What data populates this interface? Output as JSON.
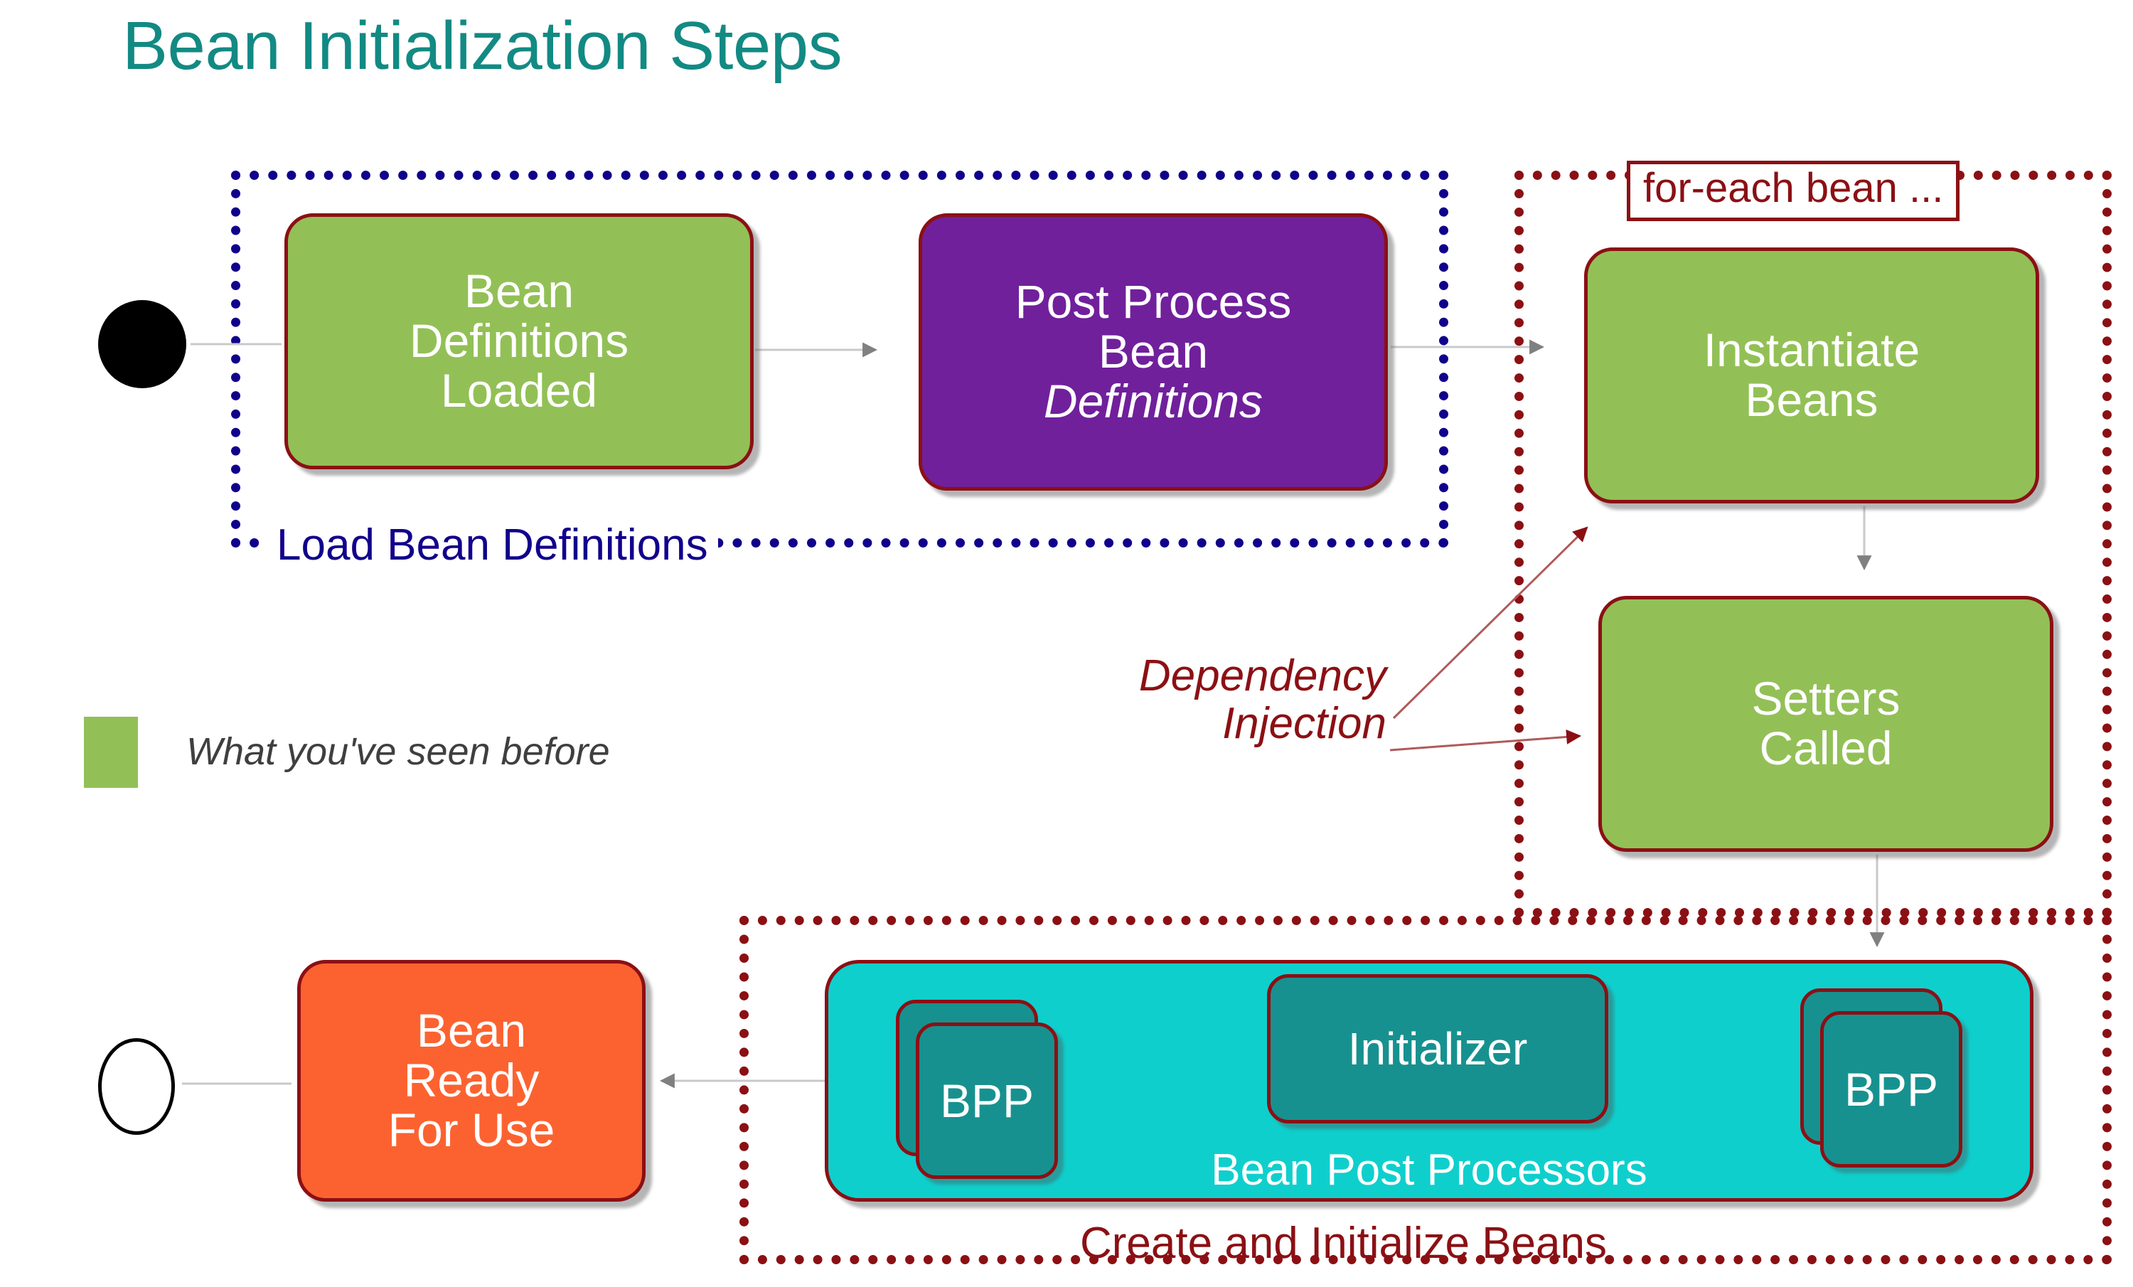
{
  "title": "Bean Initialization Steps",
  "groups": {
    "load_bean_definitions": {
      "caption": "Load Bean Definitions",
      "border_color": "#11008B"
    },
    "for_each_bean": {
      "label": "for-each bean ...",
      "border_color": "#8B1014"
    },
    "create_and_initialize_beans": {
      "caption": "Create and Initialize Beans",
      "border_color": "#8B1014"
    }
  },
  "nodes": {
    "bean_definitions_loaded": {
      "line1": "Bean",
      "line2": "Definitions",
      "line3": "Loaded",
      "color": "#92C056"
    },
    "post_process_bean_definitions": {
      "line1": "Post Process",
      "line2": "Bean",
      "line3": "Definitions",
      "color": "#70209B"
    },
    "instantiate_beans": {
      "line1": "Instantiate",
      "line2": "Beans",
      "color": "#92C056"
    },
    "setters_called": {
      "line1": "Setters",
      "line2": "Called",
      "color": "#92C056"
    },
    "bean_ready_for_use": {
      "line1": "Bean",
      "line2": "Ready",
      "line3": "For Use",
      "color": "#FC6230"
    },
    "bean_post_processors": {
      "caption": "Bean Post Processors",
      "color": "#0FCFCD"
    },
    "bpp_left": {
      "label": "BPP",
      "color": "#17918F"
    },
    "bpp_right": {
      "label": "BPP",
      "color": "#17918F"
    },
    "initializer": {
      "label": "Initializer",
      "color": "#17918F"
    }
  },
  "annotations": {
    "dependency_injection_line1": "Dependency",
    "dependency_injection_line2": "Injection"
  },
  "legend": {
    "label": "What you've seen before",
    "swatch_color": "#92C056"
  },
  "colors": {
    "title": "#128A83",
    "group_blue": "#11008B",
    "group_red": "#8B1014",
    "node_border": "#8B1014",
    "arrow_gray": "#808080",
    "arrow_red": "#8B1014"
  }
}
